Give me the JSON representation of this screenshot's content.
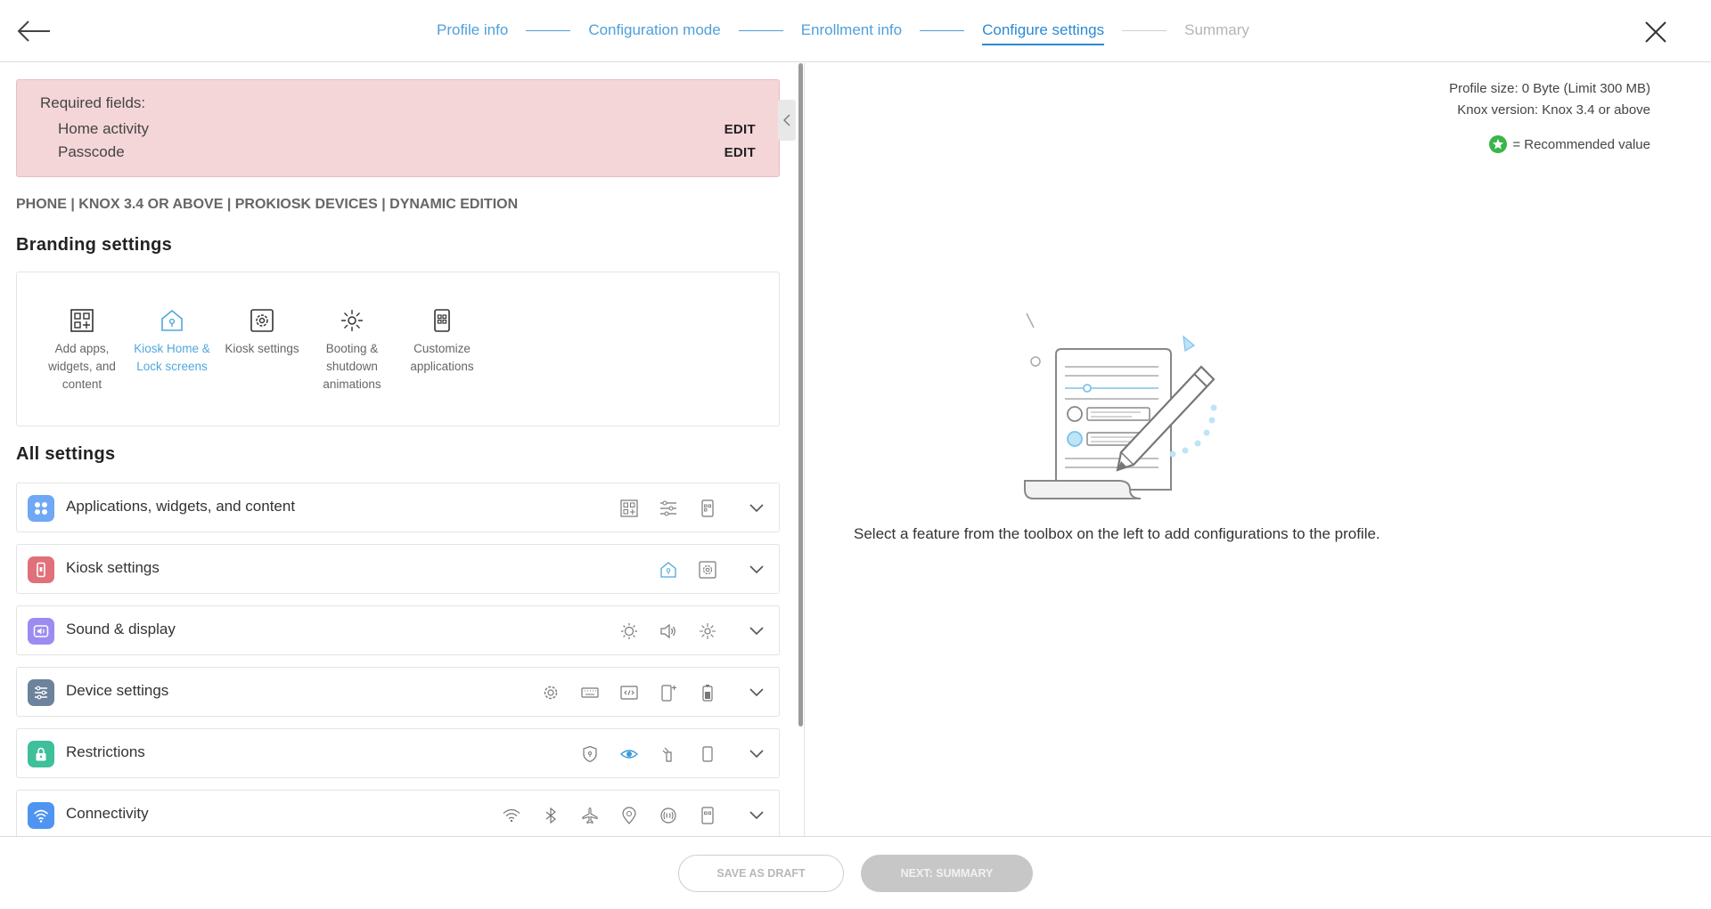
{
  "header": {
    "steps": [
      {
        "label": "Profile info",
        "state": "done"
      },
      {
        "label": "Configuration mode",
        "state": "done"
      },
      {
        "label": "Enrollment info",
        "state": "done"
      },
      {
        "label": "Configure settings",
        "state": "active"
      },
      {
        "label": "Summary",
        "state": "disabled"
      }
    ],
    "back_icon": "arrow-left-icon",
    "close_icon": "close-icon"
  },
  "required": {
    "title": "Required fields:",
    "items": [
      {
        "label": "Home activity",
        "action": "EDIT"
      },
      {
        "label": "Passcode",
        "action": "EDIT"
      }
    ]
  },
  "meta": "PHONE | KNOX 3.4 OR ABOVE | PROKIOSK DEVICES | DYNAMIC EDITION",
  "branding": {
    "title": "Branding settings",
    "items": [
      {
        "label": "Add apps, widgets, and content",
        "icon": "apps-widgets-icon"
      },
      {
        "label": "Kiosk Home & Lock screens",
        "icon": "home-lock-icon",
        "selected": true
      },
      {
        "label": "Kiosk settings",
        "icon": "kiosk-gear-icon"
      },
      {
        "label": "Booting & shutdown animations",
        "icon": "sparkle-icon"
      },
      {
        "label": "Customize applications",
        "icon": "customize-app-icon"
      }
    ]
  },
  "all_settings": {
    "title": "All settings",
    "rows": [
      {
        "label": "Applications, widgets, and content",
        "icon": "apps-icon",
        "color": "#6fa8f5"
      },
      {
        "label": "Kiosk settings",
        "icon": "kiosk-icon",
        "color": "#e0707a"
      },
      {
        "label": "Sound & display",
        "icon": "sound-icon",
        "color": "#9b8cf0"
      },
      {
        "label": "Device settings",
        "icon": "sliders-icon",
        "color": "#6d829b"
      },
      {
        "label": "Restrictions",
        "icon": "lock-icon",
        "color": "#3fbf9a"
      },
      {
        "label": "Connectivity",
        "icon": "wifi-icon",
        "color": "#4f94f0"
      }
    ]
  },
  "right": {
    "profile_size": "Profile size: 0 Byte (Limit 300 MB)",
    "knox_version": "Knox version: Knox 3.4 or above",
    "recommended": "= Recommended value",
    "empty_message": "Select a feature from the toolbox on the left to add configurations to the profile."
  },
  "footer": {
    "draft": "SAVE AS DRAFT",
    "next": "NEXT: SUMMARY"
  },
  "colors": {
    "accent": "#2a8ad4",
    "link": "#4fa0db",
    "required_bg": "#f4d6d8",
    "recommended": "#3bb54a"
  }
}
